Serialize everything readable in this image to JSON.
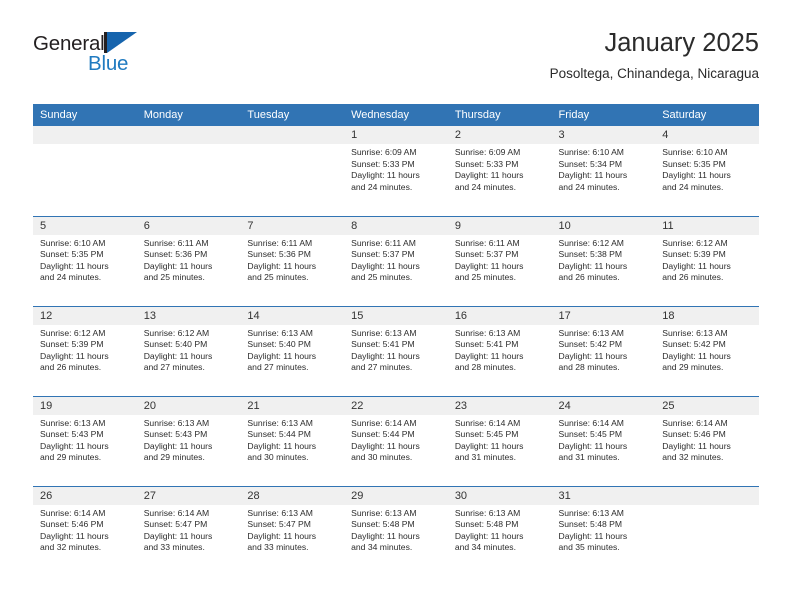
{
  "brand": {
    "name_primary": "General",
    "name_secondary": "Blue",
    "triangle_color": "#1664ad",
    "accent_color": "#1f7ac0"
  },
  "header": {
    "title": "January 2025",
    "location": "Posoltega, Chinandega, Nicaragua"
  },
  "theme": {
    "header_row_bg": "#3174b4",
    "header_row_text": "#ffffff",
    "daynum_bg": "#f0f0f0",
    "row_divider": "#3174b4",
    "page_bg": "#ffffff"
  },
  "weekday_headers": [
    "Sunday",
    "Monday",
    "Tuesday",
    "Wednesday",
    "Thursday",
    "Friday",
    "Saturday"
  ],
  "labels": {
    "sunrise_prefix": "Sunrise:",
    "sunset_prefix": "Sunset:",
    "daylight_prefix": "Daylight:"
  },
  "weeks": [
    [
      {
        "day": "",
        "sunrise": "",
        "sunset": "",
        "daylight_line1": "",
        "daylight_line2": "",
        "empty": true
      },
      {
        "day": "",
        "sunrise": "",
        "sunset": "",
        "daylight_line1": "",
        "daylight_line2": "",
        "empty": true
      },
      {
        "day": "",
        "sunrise": "",
        "sunset": "",
        "daylight_line1": "",
        "daylight_line2": "",
        "empty": true
      },
      {
        "day": "1",
        "sunrise": "Sunrise: 6:09 AM",
        "sunset": "Sunset: 5:33 PM",
        "daylight_line1": "Daylight: 11 hours",
        "daylight_line2": "and 24 minutes.",
        "empty": false
      },
      {
        "day": "2",
        "sunrise": "Sunrise: 6:09 AM",
        "sunset": "Sunset: 5:33 PM",
        "daylight_line1": "Daylight: 11 hours",
        "daylight_line2": "and 24 minutes.",
        "empty": false
      },
      {
        "day": "3",
        "sunrise": "Sunrise: 6:10 AM",
        "sunset": "Sunset: 5:34 PM",
        "daylight_line1": "Daylight: 11 hours",
        "daylight_line2": "and 24 minutes.",
        "empty": false
      },
      {
        "day": "4",
        "sunrise": "Sunrise: 6:10 AM",
        "sunset": "Sunset: 5:35 PM",
        "daylight_line1": "Daylight: 11 hours",
        "daylight_line2": "and 24 minutes.",
        "empty": false
      }
    ],
    [
      {
        "day": "5",
        "sunrise": "Sunrise: 6:10 AM",
        "sunset": "Sunset: 5:35 PM",
        "daylight_line1": "Daylight: 11 hours",
        "daylight_line2": "and 24 minutes.",
        "empty": false
      },
      {
        "day": "6",
        "sunrise": "Sunrise: 6:11 AM",
        "sunset": "Sunset: 5:36 PM",
        "daylight_line1": "Daylight: 11 hours",
        "daylight_line2": "and 25 minutes.",
        "empty": false
      },
      {
        "day": "7",
        "sunrise": "Sunrise: 6:11 AM",
        "sunset": "Sunset: 5:36 PM",
        "daylight_line1": "Daylight: 11 hours",
        "daylight_line2": "and 25 minutes.",
        "empty": false
      },
      {
        "day": "8",
        "sunrise": "Sunrise: 6:11 AM",
        "sunset": "Sunset: 5:37 PM",
        "daylight_line1": "Daylight: 11 hours",
        "daylight_line2": "and 25 minutes.",
        "empty": false
      },
      {
        "day": "9",
        "sunrise": "Sunrise: 6:11 AM",
        "sunset": "Sunset: 5:37 PM",
        "daylight_line1": "Daylight: 11 hours",
        "daylight_line2": "and 25 minutes.",
        "empty": false
      },
      {
        "day": "10",
        "sunrise": "Sunrise: 6:12 AM",
        "sunset": "Sunset: 5:38 PM",
        "daylight_line1": "Daylight: 11 hours",
        "daylight_line2": "and 26 minutes.",
        "empty": false
      },
      {
        "day": "11",
        "sunrise": "Sunrise: 6:12 AM",
        "sunset": "Sunset: 5:39 PM",
        "daylight_line1": "Daylight: 11 hours",
        "daylight_line2": "and 26 minutes.",
        "empty": false
      }
    ],
    [
      {
        "day": "12",
        "sunrise": "Sunrise: 6:12 AM",
        "sunset": "Sunset: 5:39 PM",
        "daylight_line1": "Daylight: 11 hours",
        "daylight_line2": "and 26 minutes.",
        "empty": false
      },
      {
        "day": "13",
        "sunrise": "Sunrise: 6:12 AM",
        "sunset": "Sunset: 5:40 PM",
        "daylight_line1": "Daylight: 11 hours",
        "daylight_line2": "and 27 minutes.",
        "empty": false
      },
      {
        "day": "14",
        "sunrise": "Sunrise: 6:13 AM",
        "sunset": "Sunset: 5:40 PM",
        "daylight_line1": "Daylight: 11 hours",
        "daylight_line2": "and 27 minutes.",
        "empty": false
      },
      {
        "day": "15",
        "sunrise": "Sunrise: 6:13 AM",
        "sunset": "Sunset: 5:41 PM",
        "daylight_line1": "Daylight: 11 hours",
        "daylight_line2": "and 27 minutes.",
        "empty": false
      },
      {
        "day": "16",
        "sunrise": "Sunrise: 6:13 AM",
        "sunset": "Sunset: 5:41 PM",
        "daylight_line1": "Daylight: 11 hours",
        "daylight_line2": "and 28 minutes.",
        "empty": false
      },
      {
        "day": "17",
        "sunrise": "Sunrise: 6:13 AM",
        "sunset": "Sunset: 5:42 PM",
        "daylight_line1": "Daylight: 11 hours",
        "daylight_line2": "and 28 minutes.",
        "empty": false
      },
      {
        "day": "18",
        "sunrise": "Sunrise: 6:13 AM",
        "sunset": "Sunset: 5:42 PM",
        "daylight_line1": "Daylight: 11 hours",
        "daylight_line2": "and 29 minutes.",
        "empty": false
      }
    ],
    [
      {
        "day": "19",
        "sunrise": "Sunrise: 6:13 AM",
        "sunset": "Sunset: 5:43 PM",
        "daylight_line1": "Daylight: 11 hours",
        "daylight_line2": "and 29 minutes.",
        "empty": false
      },
      {
        "day": "20",
        "sunrise": "Sunrise: 6:13 AM",
        "sunset": "Sunset: 5:43 PM",
        "daylight_line1": "Daylight: 11 hours",
        "daylight_line2": "and 29 minutes.",
        "empty": false
      },
      {
        "day": "21",
        "sunrise": "Sunrise: 6:13 AM",
        "sunset": "Sunset: 5:44 PM",
        "daylight_line1": "Daylight: 11 hours",
        "daylight_line2": "and 30 minutes.",
        "empty": false
      },
      {
        "day": "22",
        "sunrise": "Sunrise: 6:14 AM",
        "sunset": "Sunset: 5:44 PM",
        "daylight_line1": "Daylight: 11 hours",
        "daylight_line2": "and 30 minutes.",
        "empty": false
      },
      {
        "day": "23",
        "sunrise": "Sunrise: 6:14 AM",
        "sunset": "Sunset: 5:45 PM",
        "daylight_line1": "Daylight: 11 hours",
        "daylight_line2": "and 31 minutes.",
        "empty": false
      },
      {
        "day": "24",
        "sunrise": "Sunrise: 6:14 AM",
        "sunset": "Sunset: 5:45 PM",
        "daylight_line1": "Daylight: 11 hours",
        "daylight_line2": "and 31 minutes.",
        "empty": false
      },
      {
        "day": "25",
        "sunrise": "Sunrise: 6:14 AM",
        "sunset": "Sunset: 5:46 PM",
        "daylight_line1": "Daylight: 11 hours",
        "daylight_line2": "and 32 minutes.",
        "empty": false
      }
    ],
    [
      {
        "day": "26",
        "sunrise": "Sunrise: 6:14 AM",
        "sunset": "Sunset: 5:46 PM",
        "daylight_line1": "Daylight: 11 hours",
        "daylight_line2": "and 32 minutes.",
        "empty": false
      },
      {
        "day": "27",
        "sunrise": "Sunrise: 6:14 AM",
        "sunset": "Sunset: 5:47 PM",
        "daylight_line1": "Daylight: 11 hours",
        "daylight_line2": "and 33 minutes.",
        "empty": false
      },
      {
        "day": "28",
        "sunrise": "Sunrise: 6:13 AM",
        "sunset": "Sunset: 5:47 PM",
        "daylight_line1": "Daylight: 11 hours",
        "daylight_line2": "and 33 minutes.",
        "empty": false
      },
      {
        "day": "29",
        "sunrise": "Sunrise: 6:13 AM",
        "sunset": "Sunset: 5:48 PM",
        "daylight_line1": "Daylight: 11 hours",
        "daylight_line2": "and 34 minutes.",
        "empty": false
      },
      {
        "day": "30",
        "sunrise": "Sunrise: 6:13 AM",
        "sunset": "Sunset: 5:48 PM",
        "daylight_line1": "Daylight: 11 hours",
        "daylight_line2": "and 34 minutes.",
        "empty": false
      },
      {
        "day": "31",
        "sunrise": "Sunrise: 6:13 AM",
        "sunset": "Sunset: 5:48 PM",
        "daylight_line1": "Daylight: 11 hours",
        "daylight_line2": "and 35 minutes.",
        "empty": false
      },
      {
        "day": "",
        "sunrise": "",
        "sunset": "",
        "daylight_line1": "",
        "daylight_line2": "",
        "empty": true
      }
    ]
  ]
}
